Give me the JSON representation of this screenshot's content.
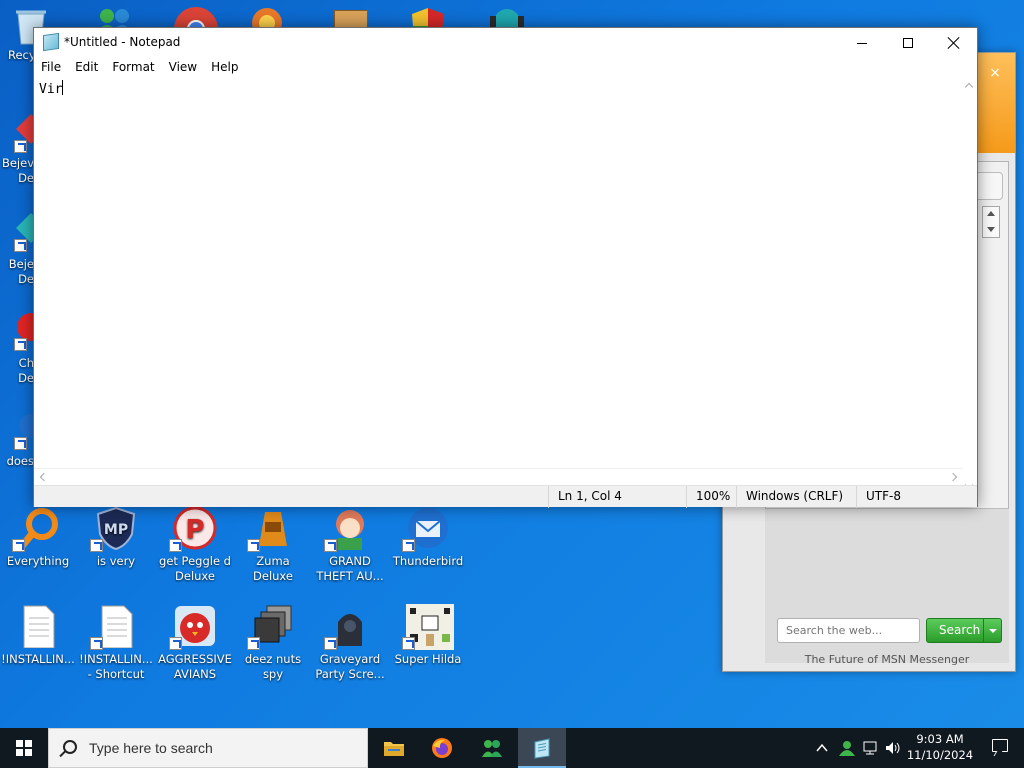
{
  "desktop": {
    "top_row_icons": [
      {
        "label": "Recy",
        "icon": "recycle-bin-icon"
      },
      {
        "label": "",
        "icon": "msn-messenger-icon"
      },
      {
        "label": "",
        "icon": "chrome-icon"
      },
      {
        "label": "",
        "icon": "app-icon"
      },
      {
        "label": "",
        "icon": "app-icon"
      },
      {
        "label": "",
        "icon": "security-shield-icon"
      },
      {
        "label": "",
        "icon": "game-character-icon"
      }
    ],
    "left_column_icons": [
      {
        "line1": "Bejev",
        "line2": "De",
        "icon": "bejeweled-icon"
      },
      {
        "line1": "Beje",
        "line2": "De",
        "icon": "bejeweled-icon"
      },
      {
        "line1": "Ch",
        "line2": "De",
        "icon": "chuzzle-icon"
      },
      {
        "line1": "does",
        "line2": "",
        "icon": "app-icon"
      }
    ],
    "row1": [
      {
        "label": "Everything",
        "icon": "everything-search-icon"
      },
      {
        "label": "is very",
        "icon": "shield-logo-icon"
      },
      {
        "label": "get Peggle d Deluxe",
        "icon": "peggle-icon"
      },
      {
        "label": "Zuma Deluxe",
        "icon": "zuma-icon"
      },
      {
        "label": "GRAND THEFT AU...",
        "icon": "anime-character-icon"
      },
      {
        "label": "Thunderbird",
        "icon": "thunderbird-icon"
      }
    ],
    "row2": [
      {
        "label": "!INSTALLIN...",
        "icon": "text-file-icon"
      },
      {
        "label": "!INSTALLIN... - Shortcut",
        "icon": "text-file-icon"
      },
      {
        "label": "AGGRESSIVE AVIANS",
        "icon": "angry-birds-icon"
      },
      {
        "label": "deez nuts spy",
        "icon": "windows-stack-icon"
      },
      {
        "label": "Graveyard Party Scre...",
        "icon": "graveyard-icon"
      },
      {
        "label": "Super Hilda",
        "icon": "pixel-game-icon"
      }
    ]
  },
  "notepad": {
    "title": "*Untitled - Notepad",
    "menu": [
      "File",
      "Edit",
      "Format",
      "View",
      "Help"
    ],
    "content": "Vir",
    "status": {
      "position": "Ln 1, Col 4",
      "zoom": "100%",
      "line_endings": "Windows (CRLF)",
      "encoding": "UTF-8"
    }
  },
  "msn": {
    "search_placeholder": "Search the web...",
    "search_button": "Search",
    "footer": "The Future of MSN Messenger",
    "close": "×"
  },
  "taskbar": {
    "search_placeholder": "Type here to search",
    "apps": [
      "file-explorer-icon",
      "firefox-icon",
      "msn-messenger-icon",
      "notepad-icon"
    ],
    "clock_time": "9:03 AM",
    "clock_date": "11/10/2024"
  },
  "colors": {
    "desktop_blue": "#0f7ae0",
    "msn_orange": "#f59a1a",
    "search_green": "#2a9c2a",
    "taskbar": "#101820"
  }
}
